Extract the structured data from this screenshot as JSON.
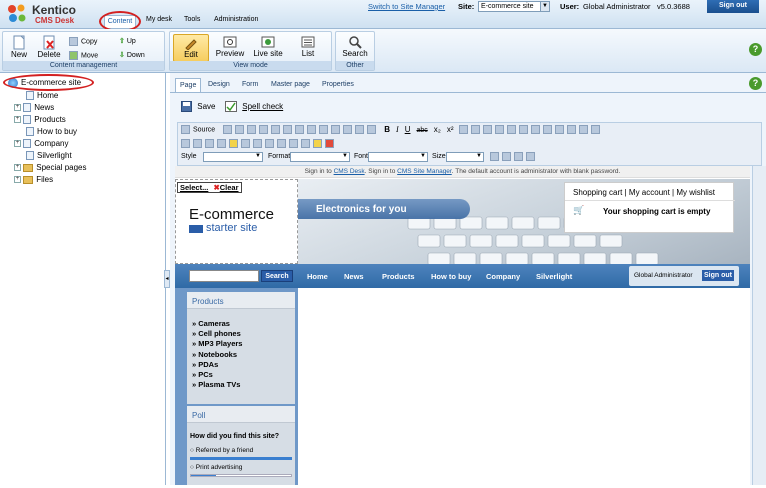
{
  "header": {
    "brand": "Kentico",
    "product": "CMS Desk",
    "tabs": [
      "Content",
      "My desk",
      "Tools",
      "Administration"
    ],
    "switch_link": "Switch to Site Manager",
    "site_label": "Site:",
    "site_value": "E-commerce site",
    "user_label": "User:",
    "user_value": "Global Administrator",
    "version": "v5.0.3688",
    "signout": "Sign out"
  },
  "ribbon": {
    "content_management": {
      "label": "Content management",
      "new": "New",
      "delete": "Delete",
      "copy": "Copy",
      "move": "Move",
      "up": "Up",
      "down": "Down"
    },
    "view_mode": {
      "label": "View mode",
      "edit": "Edit",
      "preview": "Preview",
      "live_site": "Live site",
      "list": "List"
    },
    "other": {
      "label": "Other",
      "search": "Search"
    }
  },
  "tree": {
    "root": "E-commerce site",
    "items": [
      "Home",
      "News",
      "Products",
      "How to buy",
      "Company",
      "Silverlight",
      "Special pages",
      "Files"
    ]
  },
  "editor": {
    "tabs": [
      "Page",
      "Design",
      "Form",
      "Master page",
      "Properties"
    ],
    "save": "Save",
    "spell_check": "Spell check",
    "source": "Source",
    "style_label": "Style",
    "format_label": "Format",
    "font_label": "Font",
    "size_label": "Size"
  },
  "site": {
    "notice": {
      "p1": "Sign in to ",
      "l1": "CMS Desk",
      "p2": ". Sign in to ",
      "l2": "CMS Site Manager",
      "p3": ". The default account is administrator with blank password."
    },
    "select_label": "Select...",
    "clear_label": "Clear",
    "logo_line1": "E-commerce",
    "logo_line2": "starter site",
    "banner_text": "Electronics for you",
    "cart_links": [
      "Shopping cart",
      "My account",
      "My wishlist"
    ],
    "cart_empty": "Your shopping cart is empty",
    "search_button": "Search",
    "nav": [
      "Home",
      "News",
      "Products",
      "How to buy",
      "Company",
      "Silverlight"
    ],
    "nav_user": "Global Administrator",
    "nav_signout": "Sign out",
    "products_title": "Products",
    "products": [
      "Cameras",
      "Cell phones",
      "MP3 Players",
      "Notebooks",
      "PDAs",
      "PCs",
      "Plasma TVs"
    ],
    "poll_title": "Poll",
    "poll_question": "How did you find this site?",
    "poll_options": [
      "Referred by a friend",
      "Print advertising"
    ]
  },
  "colors": {
    "accent_blue": "#2f6db4",
    "nav_blue": "#3a6ea5",
    "highlight_red": "#d32020"
  }
}
